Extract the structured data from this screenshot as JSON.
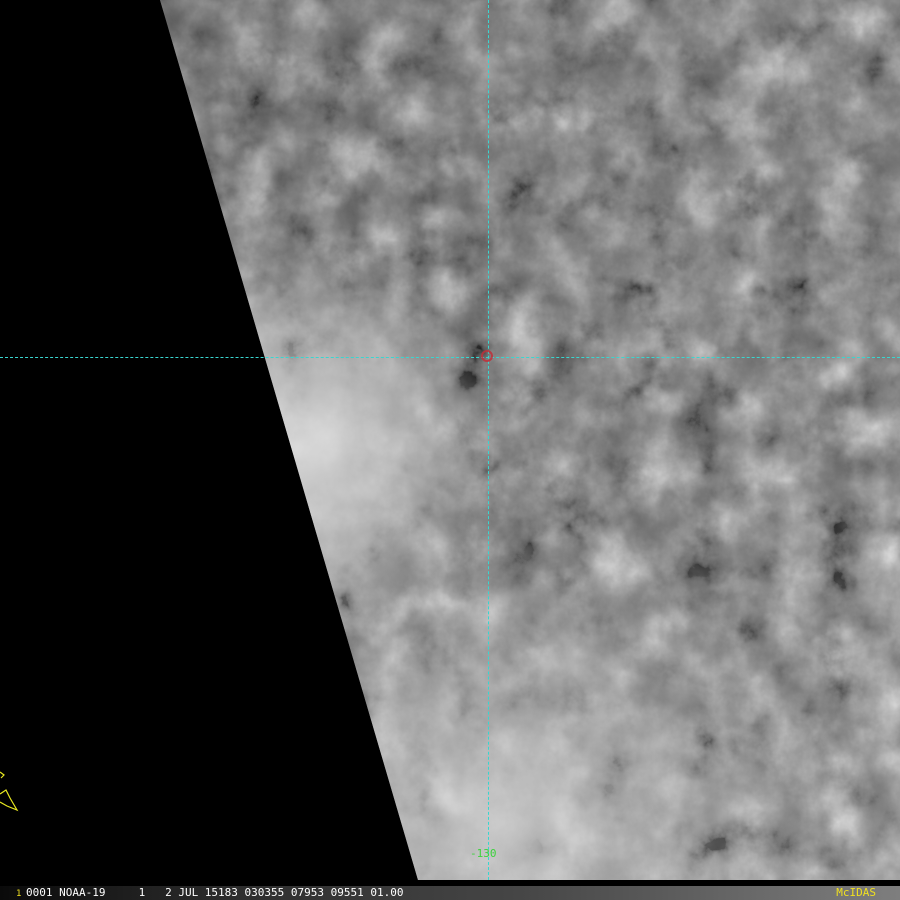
{
  "colors": {
    "background": "#000000",
    "crosshair": "#38d6d0",
    "center_marker": "#c0303a",
    "longitude_label": "#3cd23c",
    "status_text": "#ffffff",
    "frame_number": "#f0e020",
    "brand": "#f0e020",
    "coast_marker": "#e8e820"
  },
  "imagery": {
    "type": "satellite-infrared-grayscale",
    "icon": "cloud-field"
  },
  "overlay": {
    "longitude_label": "-130"
  },
  "status_bar": {
    "frame_number": "1",
    "text": "0001 NOAA-19     1   2 JUL 15183 030355 07953 09551 01.00",
    "brand": "McIDAS"
  }
}
